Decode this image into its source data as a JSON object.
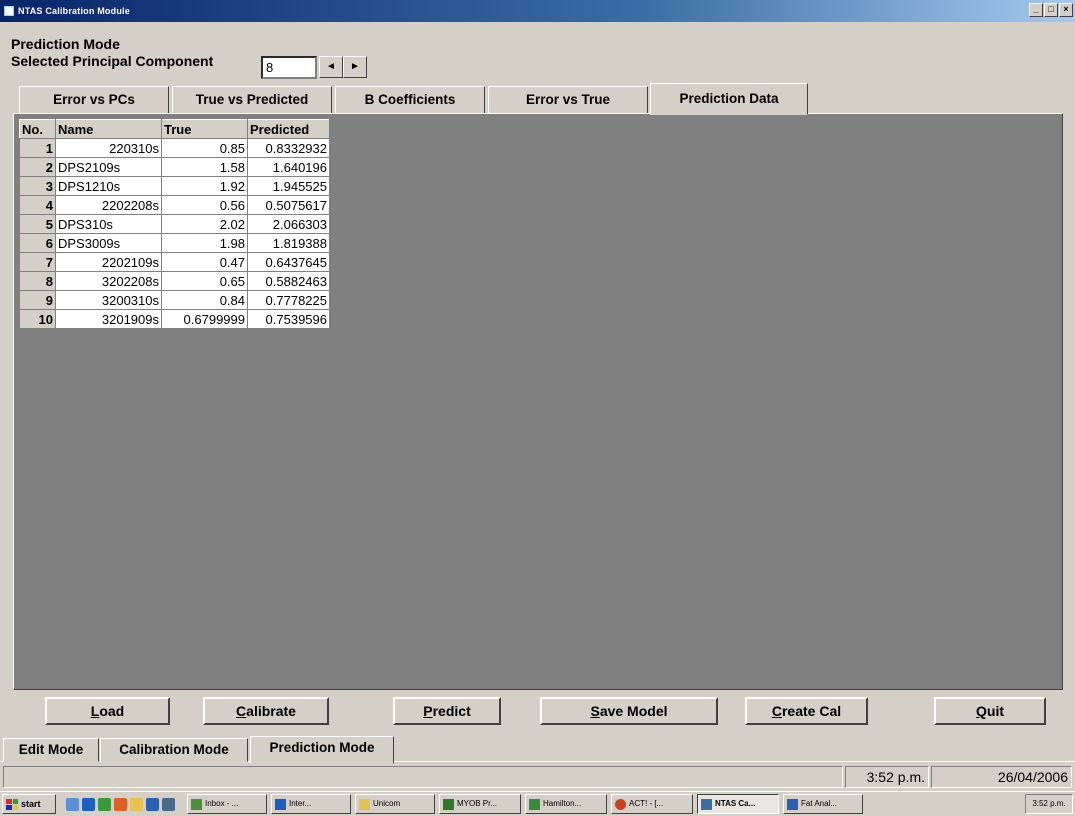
{
  "window": {
    "title": "NTAS Calibration Module",
    "controls": [
      "_",
      "□",
      "×"
    ]
  },
  "header": {
    "mode_label": "Prediction Mode",
    "pc_label": "Selected Principal Component",
    "pc_value": "8",
    "spin_left": "◄",
    "spin_right": "►"
  },
  "tabs": [
    {
      "label": "Error vs PCs"
    },
    {
      "label": "True vs Predicted"
    },
    {
      "label": "B Coefficients"
    },
    {
      "label": "Error vs True"
    },
    {
      "label": "Prediction Data",
      "active": true
    }
  ],
  "grid": {
    "headers": [
      "No.",
      "Name",
      "True",
      "Predicted"
    ],
    "rows": [
      {
        "no": "1",
        "name": "220310s",
        "true": "0.85",
        "predicted": "0.8332932"
      },
      {
        "no": "2",
        "name": "DPS2109s",
        "true": "1.58",
        "predicted": "1.640196"
      },
      {
        "no": "3",
        "name": "DPS1210s",
        "true": "1.92",
        "predicted": "1.945525"
      },
      {
        "no": "4",
        "name": "2202208s",
        "true": "0.56",
        "predicted": "0.5075617"
      },
      {
        "no": "5",
        "name": "DPS310s",
        "true": "2.02",
        "predicted": "2.066303"
      },
      {
        "no": "6",
        "name": "DPS3009s",
        "true": "1.98",
        "predicted": "1.819388"
      },
      {
        "no": "7",
        "name": "2202109s",
        "true": "0.47",
        "predicted": "0.6437645"
      },
      {
        "no": "8",
        "name": "3202208s",
        "true": "0.65",
        "predicted": "0.5882463"
      },
      {
        "no": "9",
        "name": "3200310s",
        "true": "0.84",
        "predicted": "0.7778225"
      },
      {
        "no": "10",
        "name": "3201909s",
        "true": "0.6799999",
        "predicted": "0.7539596"
      }
    ]
  },
  "buttons": [
    {
      "hot": "L",
      "rest": "oad"
    },
    {
      "hot": "C",
      "rest": "alibrate"
    },
    {
      "hot": "P",
      "rest": "redict"
    },
    {
      "hot": "S",
      "rest": "ave Model"
    },
    {
      "hot": "C",
      "rest": "reate Cal"
    },
    {
      "hot": "Q",
      "rest": "uit"
    }
  ],
  "mode_tabs": [
    {
      "label": "Edit Mode"
    },
    {
      "label": "Calibration Mode"
    },
    {
      "label": "Prediction Mode",
      "active": true
    }
  ],
  "status": {
    "time": "3:52 p.m.",
    "date": "26/04/2006"
  },
  "taskbar": {
    "start": "start",
    "tasks": [
      {
        "label": "Inbox - ...",
        "color": "#4a8f3a"
      },
      {
        "label": "Inter...",
        "color": "#1d5fc0",
        "active": false
      },
      {
        "label": "Unicom",
        "color": "#e6c250"
      },
      {
        "label": "MYOB Pr...",
        "color": "#2d7a2d"
      },
      {
        "label": "Hamilton...",
        "color": "#3a8a3a"
      },
      {
        "label": "ACT! - [...",
        "color": "#d04020"
      },
      {
        "label": "NTAS Ca...",
        "color": "#3a6ea5",
        "active": true
      },
      {
        "label": "Fat Anal...",
        "color": "#2b5fb5"
      }
    ],
    "tray_time": "3:52 p.m."
  }
}
